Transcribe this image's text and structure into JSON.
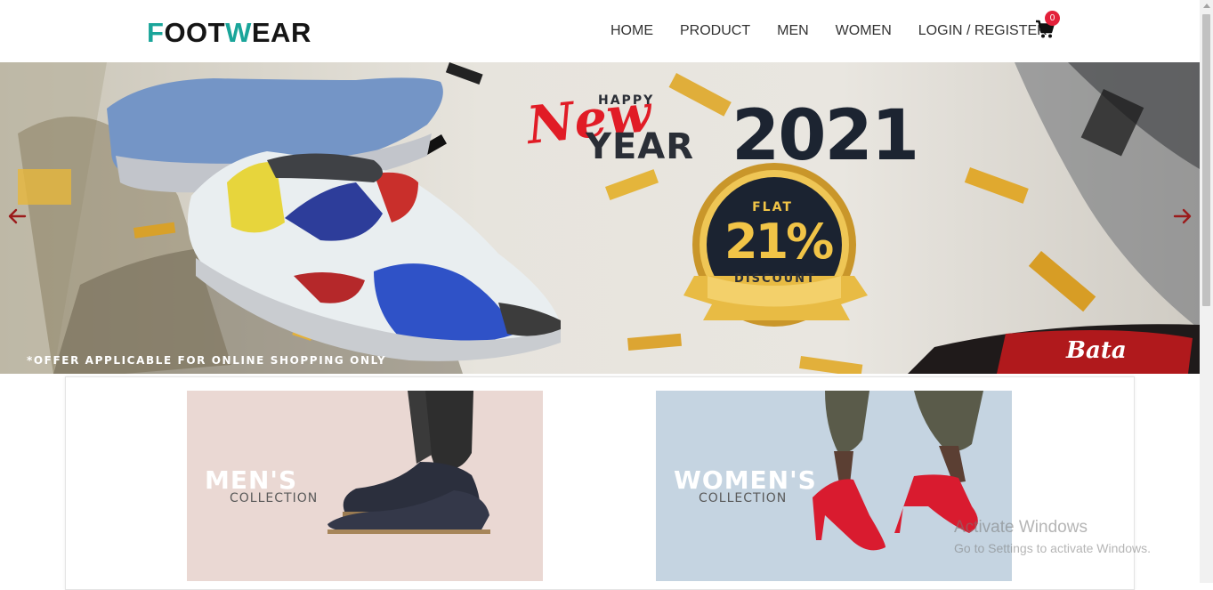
{
  "logo": {
    "part1_accent": "F",
    "part2": "OOT",
    "part3_accent": "W",
    "part4": "EAR"
  },
  "nav": {
    "items": [
      "HOME",
      "PRODUCT",
      "MEN",
      "WOMEN",
      "LOGIN / REGISTER"
    ],
    "cart_count": "0",
    "cart_icon": "cart-icon"
  },
  "colors": {
    "accent": "#1aa59a",
    "badge": "#e3203a",
    "arrow": "#9b1b1b"
  },
  "hero": {
    "happy": "HAPPY",
    "new": "New",
    "year": "YEAR",
    "number": "2021",
    "flat": "FLAT",
    "percent": "21%",
    "discount": "DISCOUNT",
    "caption": "*OFFER APPLICABLE FOR ONLINE SHOPPING ONLY",
    "brand": "Bata",
    "prev_icon": "arrow-left-icon",
    "next_icon": "arrow-right-icon"
  },
  "collections": [
    {
      "title": "MEN'S",
      "subtitle": "COLLECTION"
    },
    {
      "title": "WOMEN'S",
      "subtitle": "COLLECTION"
    }
  ],
  "watermark": {
    "line1": "Activate Windows",
    "line2": "Go to Settings to activate Windows."
  }
}
